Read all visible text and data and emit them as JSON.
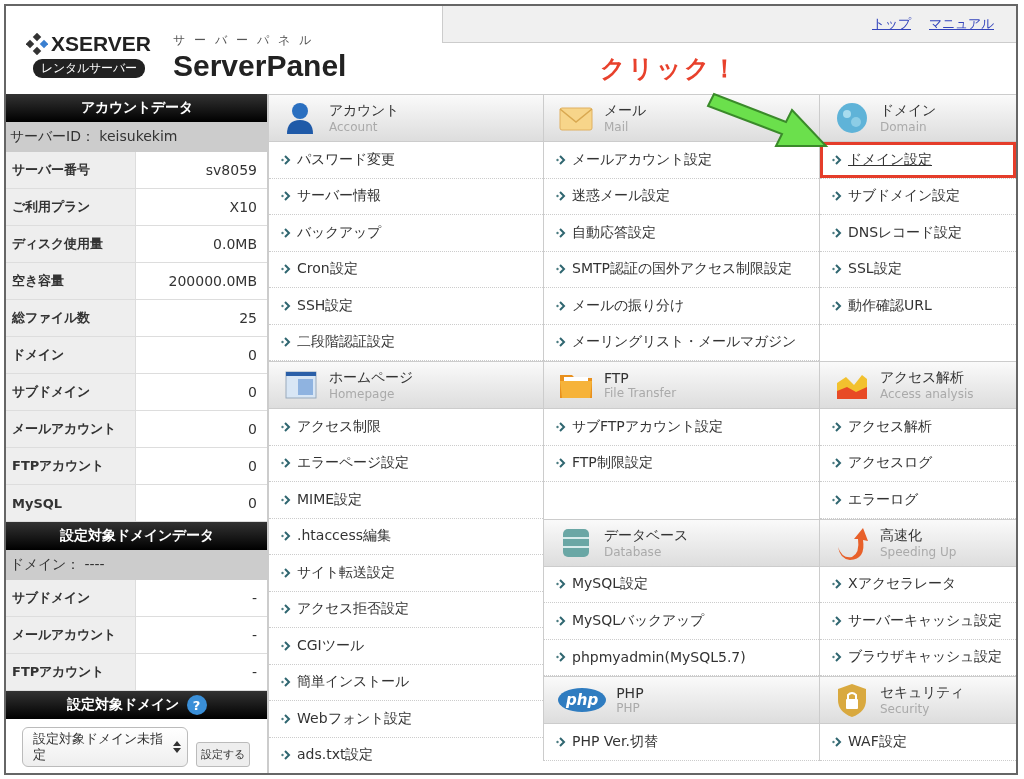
{
  "header": {
    "logo": {
      "brand": "XSERVER",
      "badge": "レンタルサーバー",
      "kana": "サーバーパネル",
      "product": "ServerPanel"
    },
    "links": [
      "トップ",
      "マニュアル"
    ]
  },
  "annotation": {
    "text": "クリック！"
  },
  "sidebar": {
    "account": {
      "title": "アカウントデータ",
      "id_line": "サーバーID： keisukekim",
      "rows": [
        {
          "label": "サーバー番号",
          "value": "sv8059"
        },
        {
          "label": "ご利用プラン",
          "value": "X10"
        },
        {
          "label": "ディスク使用量",
          "value": "0.0MB"
        },
        {
          "label": "空き容量",
          "value": "200000.0MB"
        },
        {
          "label": "総ファイル数",
          "value": "25"
        },
        {
          "label": "ドメイン",
          "value": "0"
        },
        {
          "label": "サブドメイン",
          "value": "0"
        },
        {
          "label": "メールアカウント",
          "value": "0"
        },
        {
          "label": "FTPアカウント",
          "value": "0"
        },
        {
          "label": "MySQL",
          "value": "0"
        }
      ]
    },
    "domain_data": {
      "title": "設定対象ドメインデータ",
      "id_line": "ドメイン： ----",
      "rows": [
        {
          "label": "サブドメイン",
          "value": "-"
        },
        {
          "label": "メールアカウント",
          "value": "-"
        },
        {
          "label": "FTPアカウント",
          "value": "-"
        }
      ]
    },
    "target": {
      "title": "設定対象ドメイン",
      "help": "?",
      "select": "設定対象ドメイン未指定",
      "button": "設定する"
    }
  },
  "menu": {
    "column_1": [
      {
        "kind": "account",
        "title": "アカウント",
        "subtitle": "Account",
        "items": [
          {
            "label": "パスワード変更"
          },
          {
            "label": "サーバー情報"
          },
          {
            "label": "バックアップ"
          },
          {
            "label": "Cron設定"
          },
          {
            "label": "SSH設定"
          },
          {
            "label": "二段階認証設定"
          }
        ]
      },
      {
        "kind": "homepage",
        "title": "ホームページ",
        "subtitle": "Homepage",
        "items": [
          {
            "label": "アクセス制限"
          },
          {
            "label": "エラーページ設定"
          },
          {
            "label": "MIME設定"
          },
          {
            "label": ".htaccess編集"
          },
          {
            "label": "サイト転送設定"
          },
          {
            "label": "アクセス拒否設定"
          },
          {
            "label": "CGIツール"
          },
          {
            "label": "簡単インストール"
          },
          {
            "label": "Webフォント設定"
          },
          {
            "label": "ads.txt設定"
          }
        ]
      }
    ],
    "rows": [
      [
        {
          "kind": "mail",
          "title": "メール",
          "subtitle": "Mail",
          "items": [
            {
              "label": "メールアカウント設定"
            },
            {
              "label": "迷惑メール設定"
            },
            {
              "label": "自動応答設定"
            },
            {
              "label": "SMTP認証の国外アクセス制限設定"
            },
            {
              "label": "メールの振り分け"
            },
            {
              "label": "メーリングリスト・メールマガジン"
            }
          ]
        },
        {
          "kind": "domain",
          "title": "ドメイン",
          "subtitle": "Domain",
          "items": [
            {
              "label": "ドメイン設定",
              "highlighted": true
            },
            {
              "label": "サブドメイン設定",
              "highlighted": false
            },
            {
              "label": "DNSレコード設定",
              "highlighted": false
            },
            {
              "label": "SSL設定",
              "highlighted": false
            },
            {
              "label": "動作確認URL",
              "highlighted": false
            }
          ]
        }
      ],
      [
        {
          "kind": "ftp",
          "title": "FTP",
          "subtitle": "File Transfer",
          "items": [
            {
              "label": "サブFTPアカウント設定"
            },
            {
              "label": "FTP制限設定"
            }
          ]
        },
        {
          "kind": "access",
          "title": "アクセス解析",
          "subtitle": "Access analysis",
          "items": [
            {
              "label": "アクセス解析"
            },
            {
              "label": "アクセスログ"
            },
            {
              "label": "エラーログ"
            }
          ]
        }
      ],
      [
        {
          "kind": "database",
          "title": "データベース",
          "subtitle": "Database",
          "items": [
            {
              "label": "MySQL設定"
            },
            {
              "label": "MySQLバックアップ"
            },
            {
              "label": "phpmyadmin(MySQL5.7)"
            }
          ]
        },
        {
          "kind": "speed",
          "title": "高速化",
          "subtitle": "Speeding Up",
          "items": [
            {
              "label": "Xアクセラレータ"
            },
            {
              "label": "サーバーキャッシュ設定"
            },
            {
              "label": "ブラウザキャッシュ設定"
            }
          ]
        }
      ],
      [
        {
          "kind": "php",
          "badge": "php",
          "title": "PHP",
          "subtitle": "PHP",
          "items": [
            {
              "label": "PHP Ver.切替"
            }
          ]
        },
        {
          "kind": "security",
          "title": "セキュリティ",
          "subtitle": "Security",
          "items": [
            {
              "label": "WAF設定"
            }
          ]
        }
      ]
    ]
  }
}
